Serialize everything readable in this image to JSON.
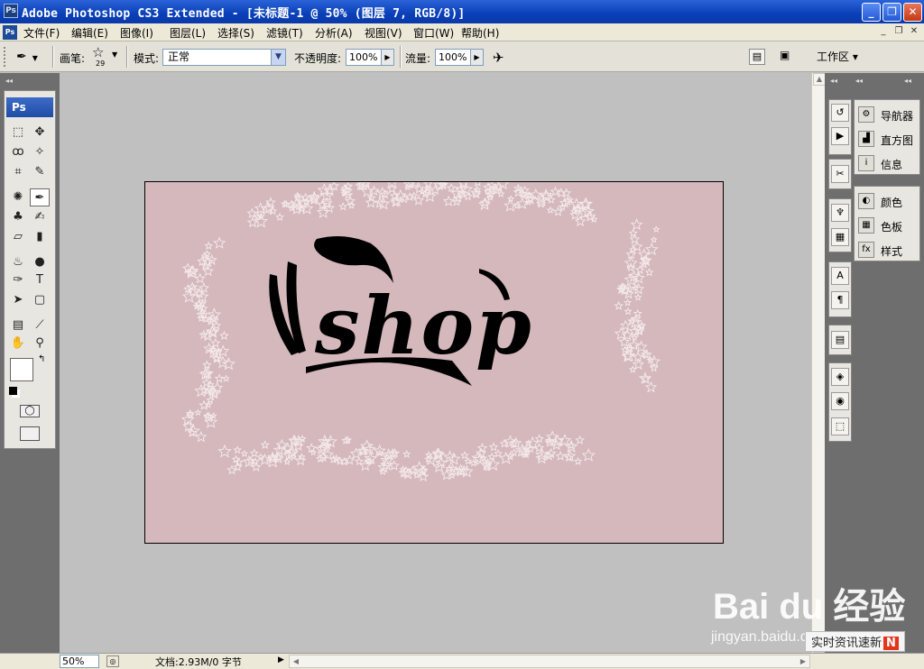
{
  "window": {
    "title": "Adobe Photoshop CS3 Extended - [未标题-1 @ 50% (图层 7, RGB/8)]",
    "app_icon": "Ps",
    "controls": [
      "minimize",
      "restore",
      "close"
    ]
  },
  "menubar": {
    "items": [
      "文件(F)",
      "编辑(E)",
      "图像(I)",
      "图层(L)",
      "选择(S)",
      "滤镜(T)",
      "分析(A)",
      "视图(V)",
      "窗口(W)",
      "帮助(H)"
    ]
  },
  "options": {
    "brush_label": "画笔:",
    "brush_size": "29",
    "mode_label": "模式:",
    "mode_value": "正常",
    "opacity_label": "不透明度:",
    "opacity_value": "100%",
    "flow_label": "流量:",
    "flow_value": "100%",
    "workspace_label": "工作区 ▾"
  },
  "toolbox": {
    "header": "Ps",
    "tools": [
      {
        "name": "marquee-tool",
        "glyph": "⬚"
      },
      {
        "name": "move-tool",
        "glyph": "✥"
      },
      {
        "name": "lasso-tool",
        "glyph": "ꝏ"
      },
      {
        "name": "magic-wand-tool",
        "glyph": "✧"
      },
      {
        "name": "crop-tool",
        "glyph": "⌗"
      },
      {
        "name": "slice-tool",
        "glyph": "✎"
      },
      {
        "name": "healing-brush-tool",
        "glyph": "✺"
      },
      {
        "name": "brush-tool",
        "glyph": "✒"
      },
      {
        "name": "clone-stamp-tool",
        "glyph": "♣"
      },
      {
        "name": "history-brush-tool",
        "glyph": "✍"
      },
      {
        "name": "eraser-tool",
        "glyph": "▱"
      },
      {
        "name": "gradient-tool",
        "glyph": "▮"
      },
      {
        "name": "blur-tool",
        "glyph": "♨"
      },
      {
        "name": "dodge-tool",
        "glyph": "●"
      },
      {
        "name": "pen-tool",
        "glyph": "✑"
      },
      {
        "name": "type-tool",
        "glyph": "T"
      },
      {
        "name": "path-selection-tool",
        "glyph": "➤"
      },
      {
        "name": "shape-tool",
        "glyph": "▢"
      },
      {
        "name": "notes-tool",
        "glyph": "▤"
      },
      {
        "name": "eyedropper-tool",
        "glyph": "⟋"
      },
      {
        "name": "hand-tool",
        "glyph": "✋"
      },
      {
        "name": "zoom-tool",
        "glyph": "⚲"
      }
    ],
    "foreground_color": "#ffffff",
    "background_color": "#d4b8bb"
  },
  "document": {
    "canvas_color": "#d4b8bb",
    "logo_text": "shop"
  },
  "right_panels": {
    "group1": [
      "导航器",
      "直方图",
      "信息"
    ],
    "group2": [
      "颜色",
      "色板",
      "样式"
    ]
  },
  "statusbar": {
    "zoom": "50%",
    "doc_info": "文档:2.93M/0 字节"
  },
  "watermark": {
    "brand": "Bai du 经验",
    "url": "jingyan.baidu.com",
    "badge": "实时资讯速新"
  }
}
